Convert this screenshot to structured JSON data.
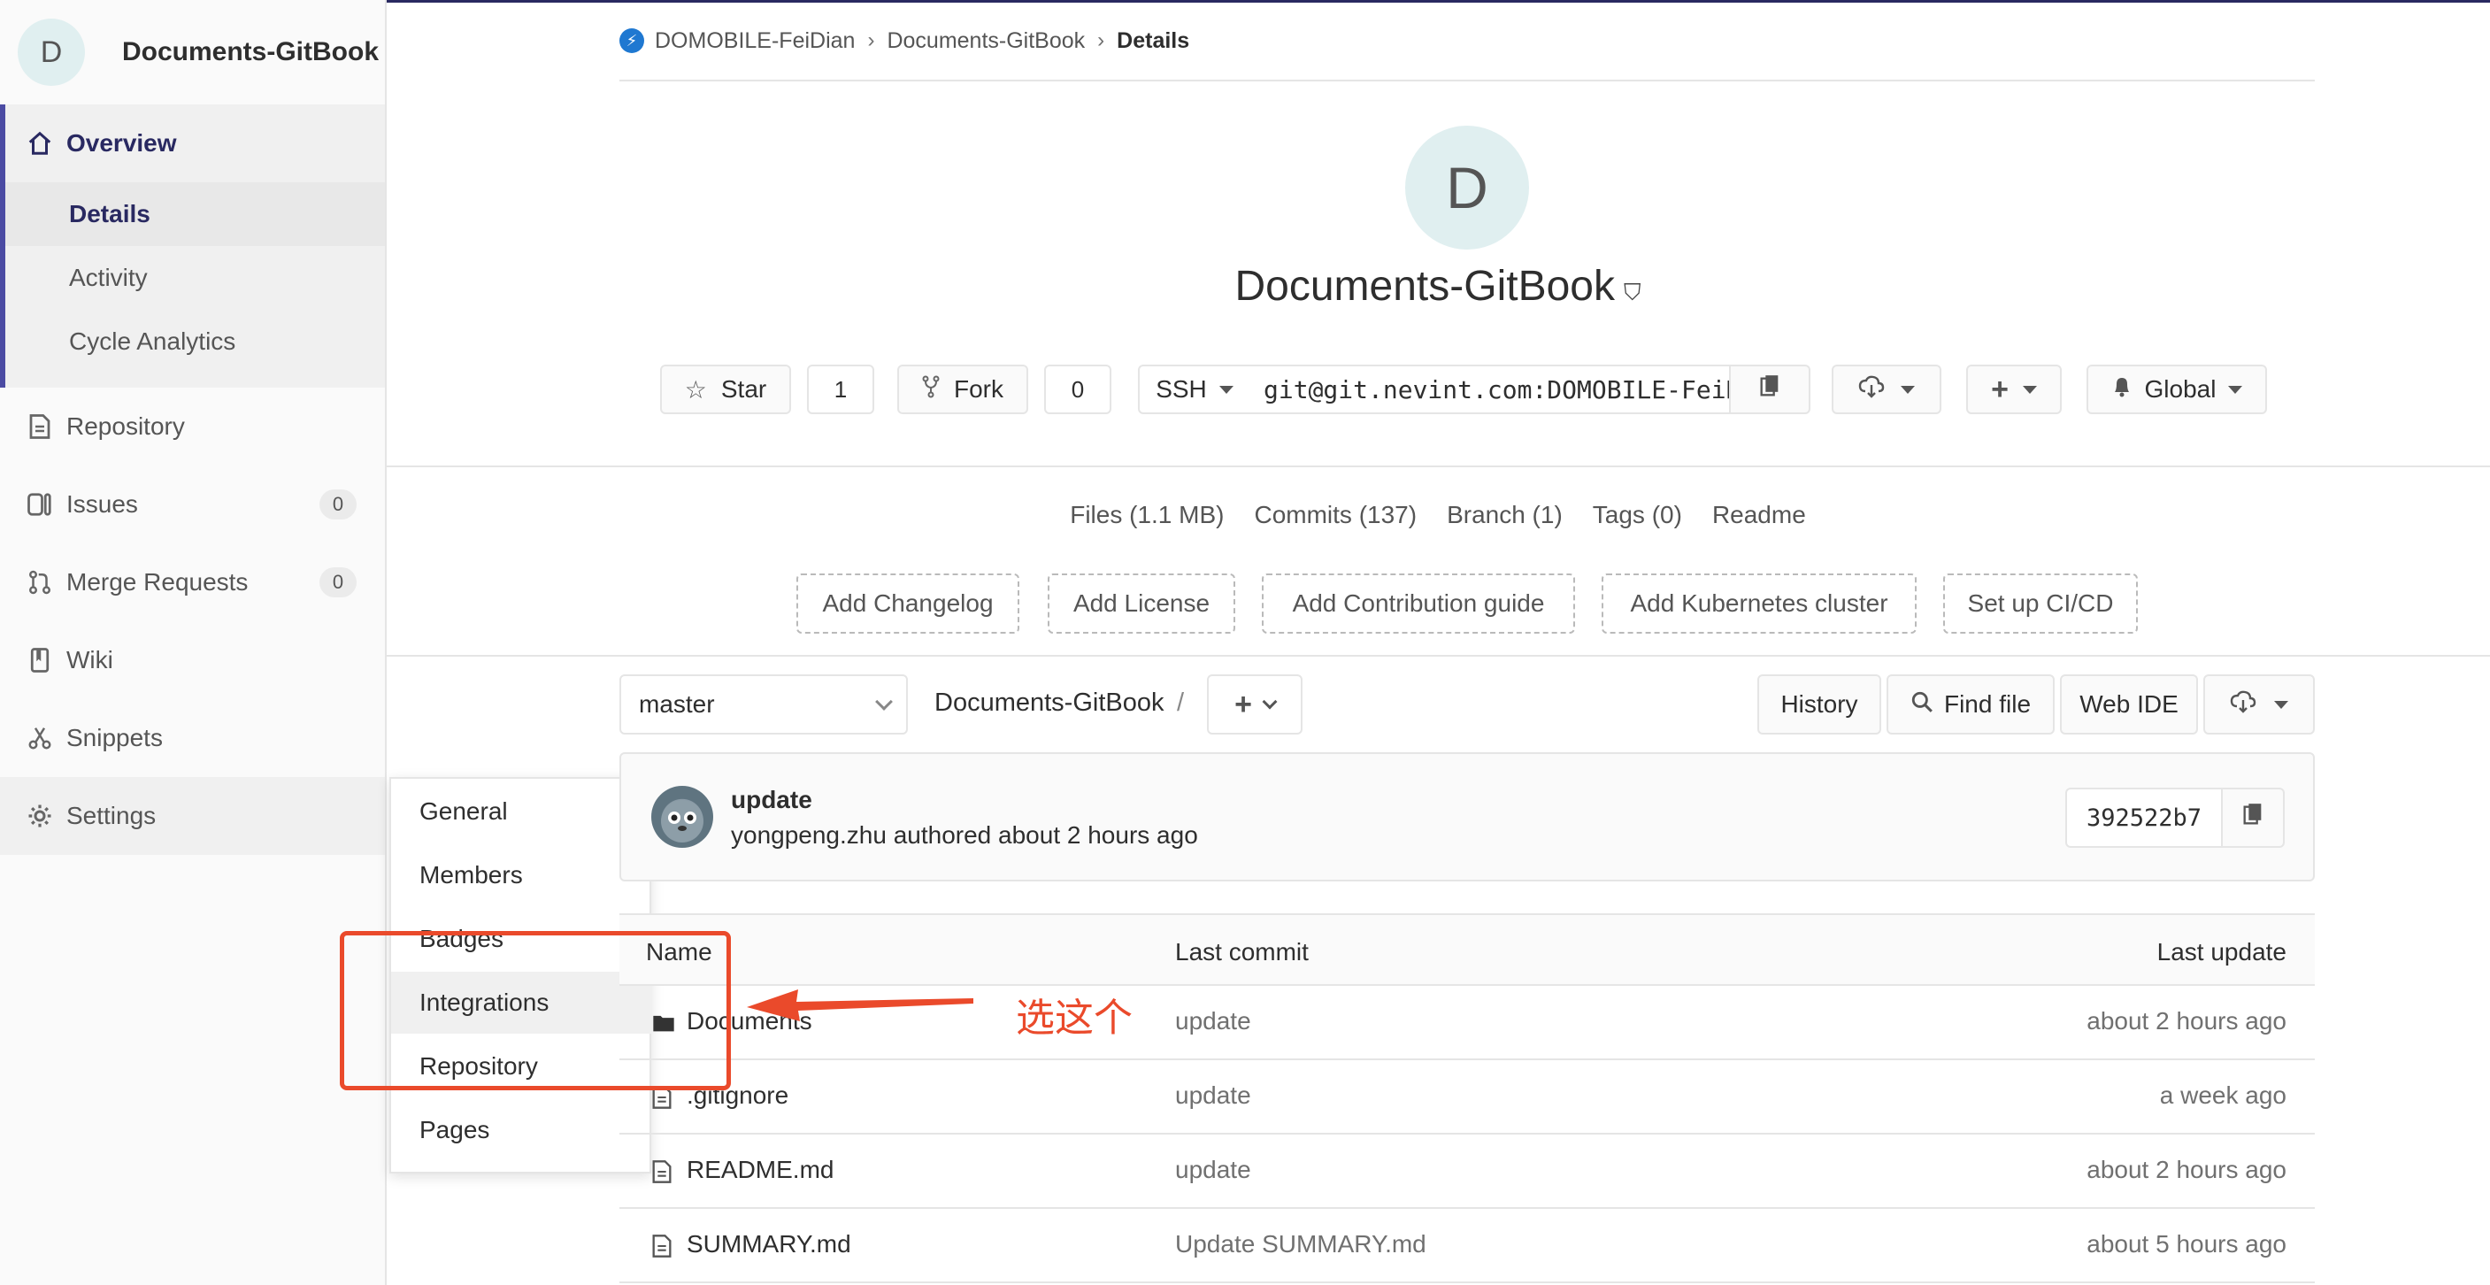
{
  "project": {
    "avatar_letter": "D",
    "name": "Documents-GitBook"
  },
  "sidebar": {
    "overview": "Overview",
    "sub": [
      "Details",
      "Activity",
      "Cycle Analytics"
    ],
    "items": [
      {
        "label": "Repository",
        "icon": "doc-icon"
      },
      {
        "label": "Issues",
        "icon": "issues-icon",
        "count": "0"
      },
      {
        "label": "Merge Requests",
        "icon": "merge-icon",
        "count": "0"
      },
      {
        "label": "Wiki",
        "icon": "book-icon"
      },
      {
        "label": "Snippets",
        "icon": "scissors-icon"
      },
      {
        "label": "Settings",
        "icon": "gear-icon"
      }
    ],
    "settings_flyout": [
      "General",
      "Members",
      "Badges",
      "Integrations",
      "Repository",
      "Pages"
    ]
  },
  "breadcrumb": {
    "group": "DOMOBILE-FeiDian",
    "project": "Documents-GitBook",
    "current": "Details"
  },
  "header": {
    "title": "Documents-GitBook",
    "star_label": "Star",
    "star_count": "1",
    "fork_label": "Fork",
    "fork_count": "0",
    "clone_protocol": "SSH",
    "clone_url": "git@git.nevint.com:DOMOBILE-FeiDian/Documents-GitBook.git",
    "notification_label": "Global"
  },
  "stats": [
    "Files (1.1 MB)",
    "Commits (137)",
    "Branch (1)",
    "Tags (0)",
    "Readme"
  ],
  "quick_actions": [
    "Add Changelog",
    "Add License",
    "Add Contribution guide",
    "Add Kubernetes cluster",
    "Set up CI/CD"
  ],
  "tree": {
    "branch": "master",
    "path": "Documents-GitBook",
    "path_sep": "/",
    "history": "History",
    "find_file": "Find file",
    "web_ide": "Web IDE"
  },
  "last_commit": {
    "title": "update",
    "meta": "yongpeng.zhu authored about 2 hours ago",
    "sha": "392522b7"
  },
  "files": {
    "headers": {
      "name": "Name",
      "commit": "Last commit",
      "date": "Last update"
    },
    "rows": [
      {
        "name": "Documents",
        "type": "folder",
        "commit": "update",
        "date": "about 2 hours ago"
      },
      {
        "name": ".gitignore",
        "type": "file",
        "commit": "update",
        "date": "a week ago"
      },
      {
        "name": "README.md",
        "type": "file",
        "commit": "update",
        "date": "about 2 hours ago"
      },
      {
        "name": "SUMMARY.md",
        "type": "file",
        "commit": "Update SUMMARY.md",
        "date": "about 5 hours ago"
      }
    ]
  },
  "annotation": {
    "text": "选这个",
    "color": "#ea4a2b"
  }
}
